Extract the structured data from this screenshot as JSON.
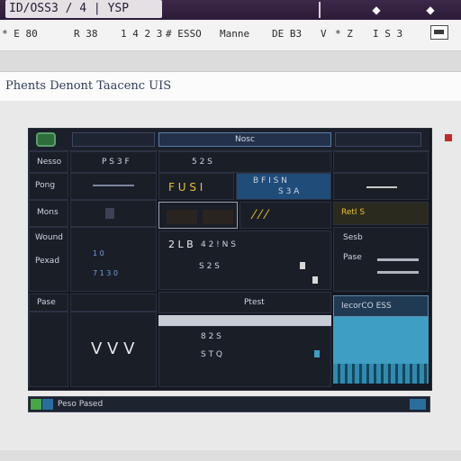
{
  "window": {
    "title": "ID/OSS3 / 4 | YSP"
  },
  "titlebar_icons": [
    "wifi-icon",
    "diamond-icon"
  ],
  "menu": {
    "items": [
      "* E 80",
      "R 38",
      "1 4 2 3",
      "# ESSO",
      "Manne",
      "DE B3",
      "V",
      "* Z",
      "I S 3"
    ]
  },
  "subtitle": "Phents Denont Taacenc UIS",
  "panel": {
    "tab_active": "Nosc",
    "left_labels": [
      "Nesso",
      "Pong",
      "Mons",
      "Wound",
      "Pexad",
      "Pase"
    ],
    "col2_header": "P S 3 F",
    "center_header": "5 2 S",
    "center_top_values": [
      "F U S I",
      "B F  I S N",
      "S 3 A"
    ],
    "center_mid_values": [
      "2 L B",
      "4 2 ! N S",
      "S 2 S"
    ],
    "center_footer_label": "Ptest",
    "center_bottom_values": [
      "8 2 S",
      "S T Q"
    ],
    "right_labels": [
      "RetI S",
      "Sesb",
      "Pase"
    ],
    "right_box_title": "IecorCO ESS",
    "middle_list": [
      "1 0",
      "7 1 3 0"
    ],
    "wave_label": "V V V"
  },
  "footer": {
    "label": "Peso Pased"
  },
  "colors": {
    "accent_blue": "#3e9ec4",
    "accent_yellow": "#e9c12a",
    "close_red": "#c22a2a",
    "green_badge": "#47a647"
  }
}
